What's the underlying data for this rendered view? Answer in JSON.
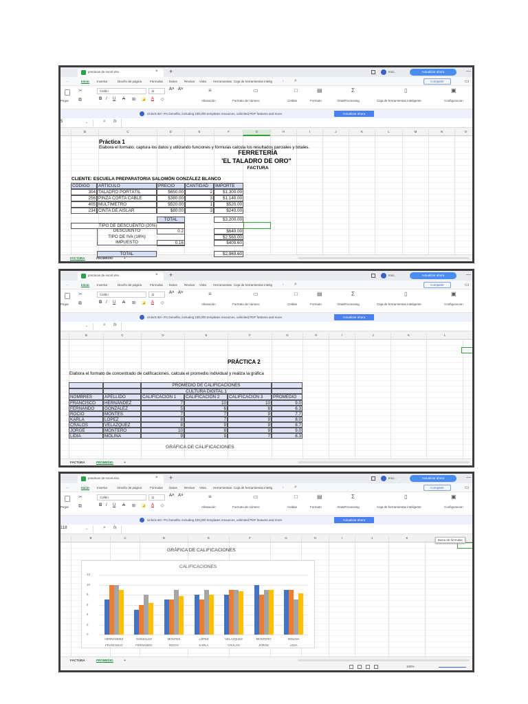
{
  "app": {
    "file_tab": "practicas de excel.xlsx",
    "new_tab": "+",
    "account": "Inici...",
    "upgrade_button": "Actualizar ahora",
    "menu": [
      "···",
      "Inicio",
      "Insertar",
      "Diseño de página",
      "Fórmulas",
      "Datos",
      "Revisar",
      "Vista",
      "Herramientas",
      "Caja de herramientas intelig"
    ],
    "share_button": "Compartir",
    "ribbon": {
      "paste": "Pegar",
      "font": "Calibri",
      "size": "11",
      "align": "Alineación",
      "number_format": "Formato de número",
      "cells": "Celdas",
      "format": "Formato",
      "data_processing": "DataProcessing",
      "smart_toolbox": "Caja de herramientas inteligente",
      "settings": "Configuracion"
    },
    "banner_text": "Unlock 80+ Pro benefits, including 100,000 templates resources, unlimited PDF features and more.",
    "banner_button": "Actualizar ahora",
    "fx": "fx",
    "sheet_tabs": [
      "FACTURA",
      "PROMEDIO",
      "+"
    ],
    "zoom_level": "100%",
    "tooltip": "Barra de fórmulas",
    "accent": "#3a9a3a"
  },
  "panels": [
    {
      "namebox": "5",
      "columns": [
        "B",
        "C",
        "D",
        "E",
        "F",
        "G",
        "H",
        "I",
        "J",
        "K",
        "L",
        "M",
        "N",
        "O"
      ],
      "active_sheet": 0
    },
    {
      "namebox": "",
      "columns": [
        "B",
        "C",
        "D",
        "E",
        "F",
        "G",
        "H",
        "I",
        "J",
        "K",
        "L"
      ],
      "active_sheet": 1
    },
    {
      "namebox": "118",
      "columns": [
        "B",
        "C",
        "D",
        "E",
        "F",
        "G",
        "H",
        "I",
        "J",
        "K"
      ],
      "active_sheet": 1
    }
  ],
  "factura": {
    "title": "Práctica 1",
    "instruction": "Elabora el formato, captura los datos y utilizando funciones y fórmulas calcula los resultados parciales y totales.",
    "company": "FERRETERÍA",
    "company_name": "'EL TALADRO DE ORO\"",
    "doc_type": "FACTURA",
    "client": "CLIENTE: ESCUELA PREPARATORIA SALOMÓN GONZÁLEZ BLANCO",
    "headers": [
      "CÓDIGO",
      "ARTÍCULO",
      "PRECIO",
      "CANTIDAD",
      "IMPORTE"
    ],
    "rows": [
      [
        "304",
        "TALADRO PORTÁTIL",
        "$650.00",
        "2",
        "$1,300.00"
      ],
      [
        "256",
        "PINZA CORTA CABLE",
        "$380.00",
        "3",
        "$1,140.00"
      ],
      [
        "405",
        "MULTIMETRO",
        "$520.00",
        "1",
        "$520.00"
      ],
      [
        "234",
        "CINTA DE AISLAR",
        "$80.00",
        "3",
        "$240.00"
      ]
    ],
    "total_label": "TOTAL",
    "total": "$3,200.00",
    "discount_type": "TIPO DE DESCUENTO (20%)",
    "discount_label": "DESCUENTO",
    "discount_rate": "0.2",
    "discount": "$640.00",
    "iva_label": "TIPO DE IVA (16%)",
    "iva_base": "$2,560.00",
    "tax_label": "IMPUESTO",
    "tax_rate": "0.16",
    "tax": "$409.60",
    "grand_total_label": "TOTAL",
    "grand_total": "$2,969.60"
  },
  "promedio": {
    "title": "PRÁCTICA 2",
    "instruction": "Elabora el formato de concentrado de calificaciones, calcula el promedio individual y realiza la gráfica",
    "header1": "PROMEDIO DE CALIFICACIONES",
    "header2": "CULTURA DIGITAL 1",
    "headers": [
      "NOMBRES",
      "APELLIDO",
      "CALIFICACIÓN 1",
      "CALIFICACIÓN 2",
      "CALIFICACIÓN 3",
      "PROMEDIO"
    ],
    "rows": [
      [
        "FRANCISCO",
        "HERNÁNDEZ",
        "7",
        "10",
        "10",
        "9.0"
      ],
      [
        "FERNANDO",
        "GONZÁLEZ",
        "5",
        "6",
        "8",
        "6.3"
      ],
      [
        "ROCIO",
        "MONTES",
        "7",
        "7",
        "9",
        "7.7"
      ],
      [
        "KARLA",
        "LÓPEZ",
        "8",
        "7",
        "9",
        "8.0"
      ],
      [
        "CRALOS",
        "VELAZQUEZ",
        "8",
        "9",
        "9",
        "8.7"
      ],
      [
        "JORGE",
        "MONTERO",
        "10",
        "8",
        "9",
        "9.0"
      ],
      [
        "LIDIA",
        "MOLINA",
        "9",
        "9",
        "7",
        "8.3"
      ]
    ],
    "chart_heading": "GRÁFICA DE CALIFICACIONES"
  },
  "chart_data": {
    "type": "bar",
    "title": "CALIFICACIONES",
    "categories": [
      [
        "HERNÁNDEZ",
        "FRANCISCO"
      ],
      [
        "GONZÁLEZ",
        "FERNANDO"
      ],
      [
        "MONTES",
        "ROCIO"
      ],
      [
        "LÓPEZ",
        "KARLA"
      ],
      [
        "VELAZQUEZ",
        "CRALOS"
      ],
      [
        "MONTERO",
        "JORGE"
      ],
      [
        "MOLINA",
        "LIDIA"
      ]
    ],
    "series": [
      {
        "name": "CALIFICACIÓN 1",
        "color": "#4472c4",
        "values": [
          7,
          5,
          7,
          8,
          8,
          10,
          9
        ]
      },
      {
        "name": "CALIFICACIÓN 2",
        "color": "#ed7d31",
        "values": [
          10,
          6,
          7,
          7,
          9,
          8,
          9
        ]
      },
      {
        "name": "CALIFICACIÓN 3",
        "color": "#a5a5a5",
        "values": [
          10,
          8,
          9,
          9,
          9,
          9,
          7
        ]
      },
      {
        "name": "PROMEDIO",
        "color": "#ffc000",
        "values": [
          9.0,
          6.3,
          7.7,
          8.0,
          8.7,
          9.0,
          8.3
        ]
      }
    ],
    "yticks": [
      "0",
      "2",
      "4",
      "6",
      "8",
      "10",
      "12"
    ],
    "ylim": [
      0,
      12
    ],
    "grid": true
  }
}
